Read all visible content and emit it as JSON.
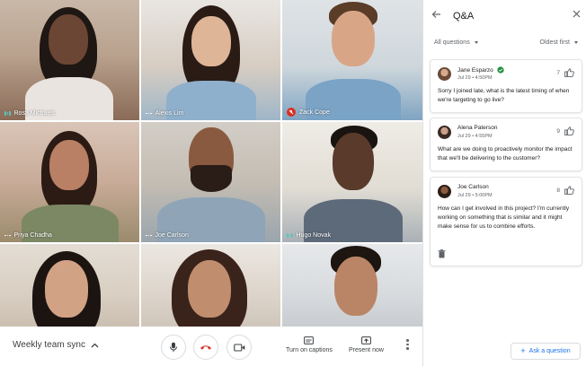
{
  "participants": [
    {
      "name": "Rosa Michaels",
      "mic": "speaking"
    },
    {
      "name": "Alexis Lim",
      "mic": "idle"
    },
    {
      "name": "Zack Cope",
      "mic": "muted"
    },
    {
      "name": "Priya Chadha",
      "mic": "idle"
    },
    {
      "name": "Joe Carlson",
      "mic": "idle"
    },
    {
      "name": "Hugo Novak",
      "mic": "speaking"
    },
    {
      "name": "",
      "mic": ""
    },
    {
      "name": "",
      "mic": ""
    },
    {
      "name": "",
      "mic": ""
    }
  ],
  "meeting": {
    "title": "Weekly team sync"
  },
  "toolbar": {
    "captions_label": "Turn on captions",
    "present_label": "Present now"
  },
  "qa": {
    "title": "Q&A",
    "filter": "All questions",
    "sort": "Oldest first",
    "ask_label": "Ask a question",
    "questions": [
      {
        "author": "Jane Esparzo",
        "timestamp": "Jul 29 • 4:50PM",
        "votes": "7",
        "text": "Sorry I joined late, what is the latest timing of when we're targeting to go live?"
      },
      {
        "author": "Alena Paterson",
        "timestamp": "Jul 29 • 4:55PM",
        "votes": "9",
        "text": "What are we doing to proactively monitor the impact that we'll be delivering to the customer?"
      },
      {
        "author": "Joe Carlson",
        "timestamp": "Jul 29 • 5:00PM",
        "votes": "8",
        "text": "How can I get involved in this project? I'm currently working on something that is similar and it might make sense for us to combine efforts."
      }
    ]
  },
  "colors": {
    "end_call": "#d93025",
    "speaking": "#5bc6b9",
    "accent": "#1a73e8",
    "verified": "#1e8e3e"
  }
}
